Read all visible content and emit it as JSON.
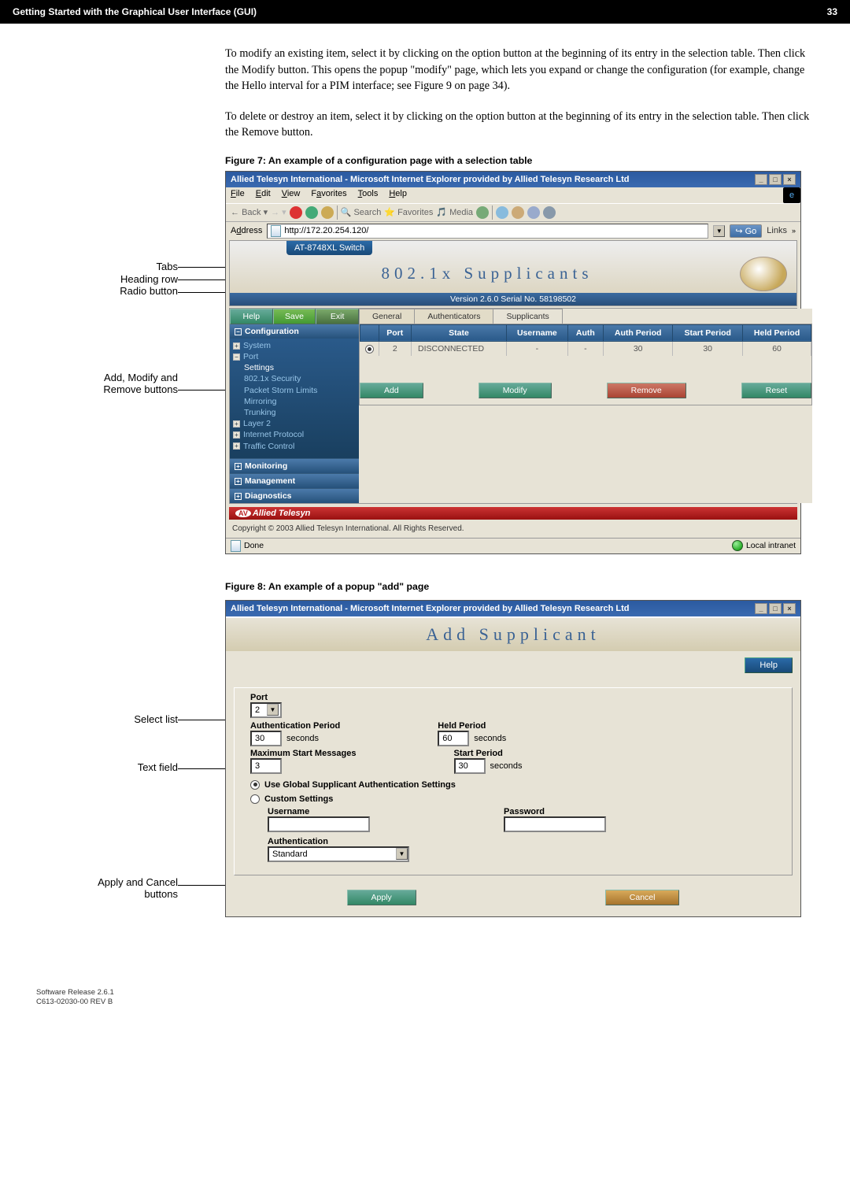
{
  "doc": {
    "header_left": "Getting Started with the Graphical User Interface (GUI)",
    "header_right": "33",
    "para1": "To modify an existing item, select it by clicking on the option button at the beginning of its entry in the selection table. Then click the Modify button. This opens the popup \"modify\" page, which lets you expand or change the configuration (for example, change the Hello interval for a PIM interface; see Figure 9 on page 34).",
    "para2": "To delete or destroy an item, select it by clicking on the option button at the beginning of its entry in the selection table. Then click the Remove button.",
    "fig7_caption": "Figure 7: An example of a configuration page with a selection table",
    "fig8_caption": "Figure 8: An example of a popup \"add\" page",
    "footer1": "Software Release 2.6.1",
    "footer2": "C613-02030-00 REV B"
  },
  "callouts7": {
    "tabs": "Tabs",
    "heading": "Heading row",
    "radio": "Radio button",
    "addmod": "Add, Modify and",
    "remove": "Remove buttons"
  },
  "callouts8": {
    "select": "Select list",
    "text": "Text field",
    "applycancel": "Apply and Cancel",
    "buttons": "buttons"
  },
  "ie": {
    "title": "Allied Telesyn International - Microsoft Internet Explorer provided by Allied Telesyn Research Ltd",
    "menu_file": "File",
    "menu_edit": "Edit",
    "menu_view": "View",
    "menu_fav": "Favorites",
    "menu_tools": "Tools",
    "menu_help": "Help",
    "tb_back": "Back",
    "tb_search": "Search",
    "tb_favs": "Favorites",
    "tb_media": "Media",
    "addr_lbl": "Address",
    "addr_val": "http://172.20.254.120/",
    "go": "Go",
    "links": "Links",
    "status_done": "Done",
    "status_intranet": "Local intranet"
  },
  "app": {
    "switch_label": "AT-8748XL Switch",
    "title": "802.1x Supplicants",
    "version": "Version 2.6.0  Serial No. 58198502",
    "tabs": {
      "help": "Help",
      "save": "Save",
      "exit": "Exit"
    },
    "sidebar": {
      "config": "Configuration",
      "system": "System",
      "port": "Port",
      "settings": "Settings",
      "sec": "802.1x Security",
      "storm": "Packet Storm Limits",
      "mirror": "Mirroring",
      "trunk": "Trunking",
      "layer2": "Layer 2",
      "ip": "Internet Protocol",
      "traffic": "Traffic Control",
      "monitoring": "Monitoring",
      "management": "Management",
      "diagnostics": "Diagnostics"
    },
    "maintabs": {
      "general": "General",
      "auth": "Authenticators",
      "supp": "Supplicants"
    },
    "th": {
      "port": "Port",
      "state": "State",
      "user": "Username",
      "auth": "Auth",
      "aperiod": "Auth Period",
      "speriod": "Start Period",
      "hperiod": "Held Period"
    },
    "row": {
      "port": "2",
      "state": "DISCONNECTED",
      "user": "-",
      "auth": "-",
      "aperiod": "30",
      "speriod": "30",
      "hperiod": "60"
    },
    "btn": {
      "add": "Add",
      "modify": "Modify",
      "remove": "Remove",
      "reset": "Reset"
    },
    "brand": "Allied Telesyn",
    "copyright": "Copyright © 2003 Allied Telesyn International. All Rights Reserved."
  },
  "popup": {
    "title": "Add Supplicant",
    "help": "Help",
    "port_lbl": "Port",
    "port_val": "2",
    "authp_lbl": "Authentication Period",
    "authp_val": "30",
    "heldp_lbl": "Held Period",
    "heldp_val": "60",
    "maxmsg_lbl": "Maximum Start Messages",
    "maxmsg_val": "3",
    "startp_lbl": "Start Period",
    "startp_val": "30",
    "seconds": "seconds",
    "use_global": "Use Global Supplicant Authentication Settings",
    "custom": "Custom Settings",
    "username": "Username",
    "password": "Password",
    "auth_lbl": "Authentication",
    "auth_val": "Standard",
    "apply": "Apply",
    "cancel": "Cancel"
  }
}
